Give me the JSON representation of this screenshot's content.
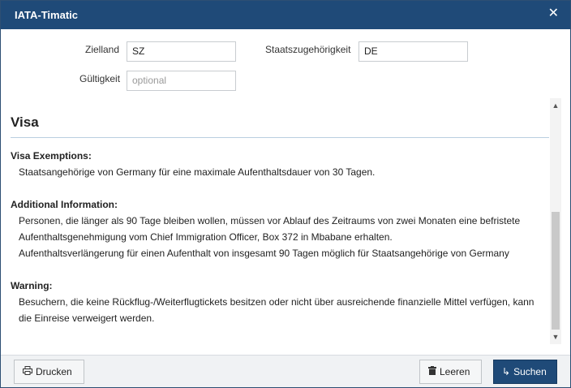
{
  "window": {
    "title": "IATA-Timatic",
    "close_icon": "close-icon"
  },
  "form": {
    "zielland_label": "Zielland",
    "zielland_value": "SZ",
    "staats_label": "Staatszugehörigkeit",
    "staats_value": "DE",
    "gueltigkeit_label": "Gültigkeit",
    "gueltigkeit_placeholder": "optional"
  },
  "content": {
    "heading": "Visa",
    "sections": [
      {
        "title": "Visa Exemptions:",
        "lines": [
          "Staatsangehörige von Germany für eine maximale Aufenthaltsdauer von 30 Tagen."
        ]
      },
      {
        "title": "Additional Information:",
        "lines": [
          "Personen, die länger als 90 Tage bleiben wollen, müssen vor Ablauf des Zeitraums von zwei Monaten eine befristete",
          "Aufenthaltsgenehmigung vom Chief Immigration Officer, Box 372 in Mbabane erhalten.",
          "Aufenthaltsverlängerung für einen Aufenthalt von insgesamt 90 Tagen möglich für Staatsangehörige von Germany"
        ]
      },
      {
        "title": "Warning:",
        "lines": [
          "Besuchern, die keine Rückflug-/Weiterflugtickets besitzen oder nicht über ausreichende finanzielle Mittel verfügen, kann",
          "die Einreise verweigert werden."
        ]
      }
    ]
  },
  "footer": {
    "print_label": "Drucken",
    "clear_label": "Leeren",
    "search_label": "Suchen"
  }
}
